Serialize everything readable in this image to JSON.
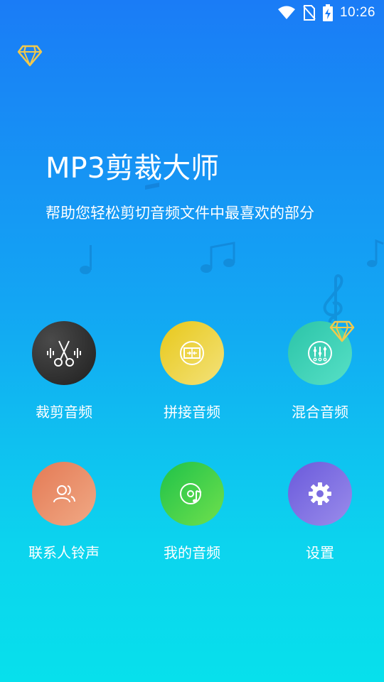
{
  "status_bar": {
    "time": "10:26",
    "icons": [
      "wifi-icon",
      "no-sim-icon",
      "battery-charging-icon"
    ]
  },
  "header": {
    "premium_icon": "diamond-icon"
  },
  "hero": {
    "title": "MP3剪裁大师",
    "subtitle": "帮助您轻松剪切音频文件中最喜欢的部分"
  },
  "features": [
    {
      "label": "裁剪音频",
      "icon": "scissors-icon"
    },
    {
      "label": "拼接音频",
      "icon": "merge-icon"
    },
    {
      "label": "混合音频",
      "icon": "mixer-icon",
      "premium": true
    },
    {
      "label": "联系人铃声",
      "icon": "contacts-icon"
    },
    {
      "label": "我的音频",
      "icon": "music-disc-icon"
    },
    {
      "label": "设置",
      "icon": "gear-icon"
    }
  ],
  "colors": {
    "gradient_top": "#1A7CF6",
    "gradient_bottom": "#07E0EC",
    "premium_gold": "#F2C94C"
  }
}
